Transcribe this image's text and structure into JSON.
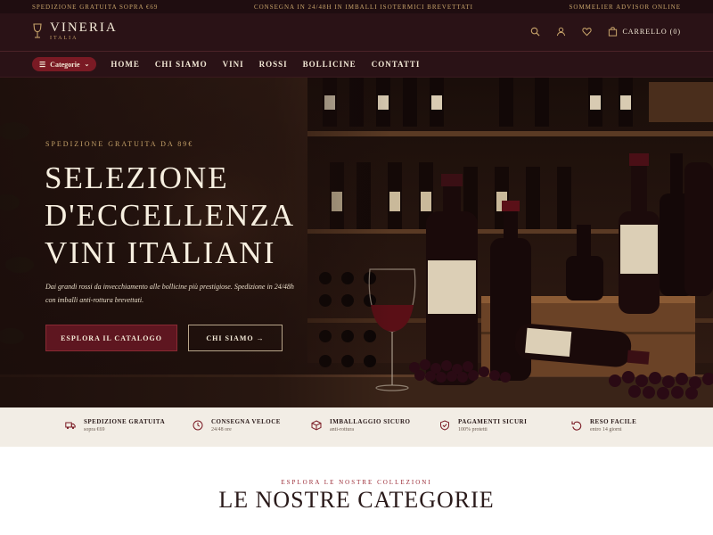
{
  "topbar": {
    "left": "SPEDIZIONE GRATUITA SOPRA €69",
    "center": "CONSEGNA IN 24/48H IN IMBALLI ISOTERMICI BREVETTATI",
    "right": "SOMMELIER ADVISOR ONLINE"
  },
  "header": {
    "logo_main": "VINERIA",
    "logo_sub": "ITALIA",
    "cart_label": "CARRELLO (0)",
    "icons": [
      "search-icon",
      "user-icon",
      "heart-icon",
      "bag-icon"
    ]
  },
  "nav": {
    "categories_label": "Categorie",
    "links": [
      "HOME",
      "CHI SIAMO",
      "VINI",
      "ROSSI",
      "BOLLICINE",
      "CONTATTI"
    ]
  },
  "hero": {
    "kicker": "SPEDIZIONE GRATUITA DA 89€",
    "title_lines": [
      "SELEZIONE",
      "D'ECCELLENZA",
      "VINI ITALIANI"
    ],
    "description": "Dai grandi rossi da invecchiamento alle bollicine più prestigiose. Spedizione in 24/48h con imballi anti-rottura brevettati.",
    "primary_button": "ESPLORA IL CATALOGO",
    "secondary_button": "CHI SIAMO →"
  },
  "features": [
    {
      "title": "SPEDIZIONE GRATUITA",
      "sub": "sopra €69",
      "icon": "truck-icon"
    },
    {
      "title": "CONSEGNA VELOCE",
      "sub": "24/48 ore",
      "icon": "clock-icon"
    },
    {
      "title": "IMBALLAGGIO SICURO",
      "sub": "anti-rottura",
      "icon": "box-icon"
    },
    {
      "title": "PAGAMENTI SICURI",
      "sub": "100% protetti",
      "icon": "shield-icon"
    },
    {
      "title": "RESO FACILE",
      "sub": "entro 14 giorni",
      "icon": "return-icon"
    }
  ],
  "section": {
    "kicker": "ESPLORA LE NOSTRE COLLEZIONI",
    "title": "LE NOSTRE CATEGORIE"
  },
  "colors": {
    "accent": "#7a1a24",
    "gold": "#c7a36a",
    "header_bg": "#2a1216"
  }
}
